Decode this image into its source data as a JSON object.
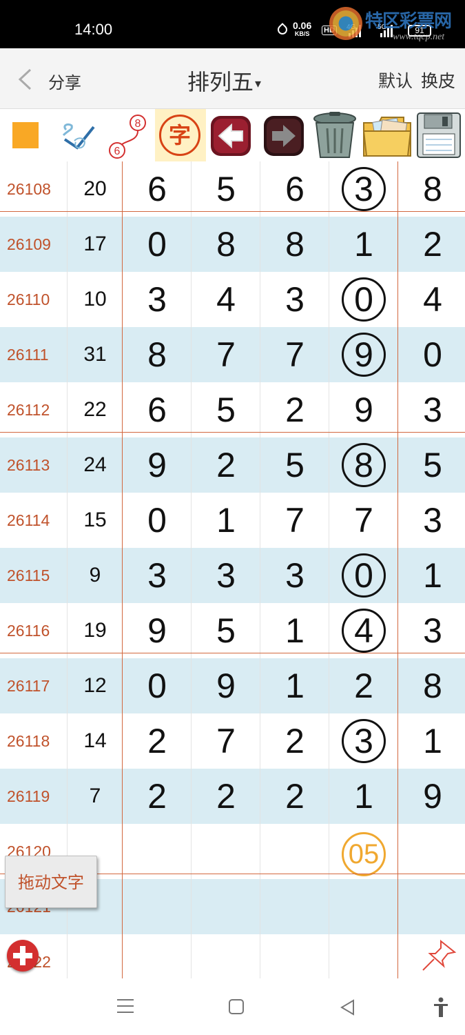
{
  "status_bar": {
    "time": "14:00",
    "speed_value": "0.06",
    "speed_unit": "KB/S",
    "hd_label": "HD",
    "net1": "4G",
    "net2": "5G",
    "battery": "91"
  },
  "watermark": {
    "text": "特区彩票网",
    "url": "www.tqcp.net"
  },
  "header": {
    "back_icon": "chevron-left-icon",
    "share_label": "分享",
    "title": "排列五",
    "title_caret": "▾",
    "default_label": "默认",
    "skin_label": "换皮"
  },
  "toolbar": {
    "char_label": "字",
    "tool_line_numbers": [
      "6",
      "8"
    ],
    "icons": [
      "orange-square-icon",
      "checkmark-scribble-icon",
      "connect-line-icon",
      "char-icon",
      "arrow-left-icon",
      "arrow-right-icon",
      "trash-icon",
      "folder-icon",
      "save-disk-icon"
    ],
    "colors": {
      "square": "#f9a825",
      "char_ring": "#d84315"
    }
  },
  "rows": [
    {
      "issue": "26108",
      "sum": "20",
      "digits": [
        "6",
        "5",
        "6",
        "3",
        "8"
      ]
    },
    {
      "issue": "26109",
      "sum": "17",
      "digits": [
        "0",
        "8",
        "8",
        "1",
        "2"
      ]
    },
    {
      "issue": "26110",
      "sum": "10",
      "digits": [
        "3",
        "4",
        "3",
        "0",
        "4"
      ]
    },
    {
      "issue": "26111",
      "sum": "31",
      "digits": [
        "8",
        "7",
        "7",
        "9",
        "0"
      ]
    },
    {
      "issue": "26112",
      "sum": "22",
      "digits": [
        "6",
        "5",
        "2",
        "9",
        "3"
      ]
    },
    {
      "issue": "26113",
      "sum": "24",
      "digits": [
        "9",
        "2",
        "5",
        "8",
        "5"
      ]
    },
    {
      "issue": "26114",
      "sum": "15",
      "digits": [
        "0",
        "1",
        "7",
        "7",
        "3"
      ]
    },
    {
      "issue": "26115",
      "sum": "9",
      "digits": [
        "3",
        "3",
        "3",
        "0",
        "1"
      ]
    },
    {
      "issue": "26116",
      "sum": "19",
      "digits": [
        "9",
        "5",
        "1",
        "4",
        "3"
      ]
    },
    {
      "issue": "26117",
      "sum": "12",
      "digits": [
        "0",
        "9",
        "1",
        "2",
        "8"
      ]
    },
    {
      "issue": "26118",
      "sum": "14",
      "digits": [
        "2",
        "7",
        "2",
        "3",
        "1"
      ]
    },
    {
      "issue": "26119",
      "sum": "7",
      "digits": [
        "2",
        "2",
        "2",
        "1",
        "9"
      ]
    },
    {
      "issue": "26120",
      "sum": "",
      "digits": [
        "",
        "",
        "",
        "05",
        ""
      ]
    },
    {
      "issue": "26121",
      "sum": "",
      "digits": [
        "",
        "",
        "",
        "",
        ""
      ]
    },
    {
      "issue": "26122",
      "sum": "",
      "digits": [
        "",
        "",
        "",
        "",
        ""
      ]
    }
  ],
  "circles": [
    {
      "row": 0,
      "col": 3,
      "color": "red"
    },
    {
      "row": 2,
      "col": 3,
      "color": "red"
    },
    {
      "row": 3,
      "col": 3,
      "color": "blue"
    },
    {
      "row": 5,
      "col": 3,
      "color": "blue"
    },
    {
      "row": 7,
      "col": 3,
      "color": "blue"
    },
    {
      "row": 8,
      "col": 3,
      "color": "orange"
    },
    {
      "row": 10,
      "col": 3,
      "color": "orange"
    },
    {
      "row": 12,
      "col": 3,
      "color": "orange"
    }
  ],
  "circle_colors": {
    "red": "#c62828",
    "blue": "#2f80d1",
    "orange": "#f0a830"
  },
  "floating": {
    "drag_text_label": "拖动文字",
    "add_icon": "plus-icon",
    "pin_icon": "pin-icon"
  },
  "nav": {
    "icons": [
      "menu-icon",
      "home-icon",
      "back-icon",
      "accessibility-icon"
    ]
  }
}
